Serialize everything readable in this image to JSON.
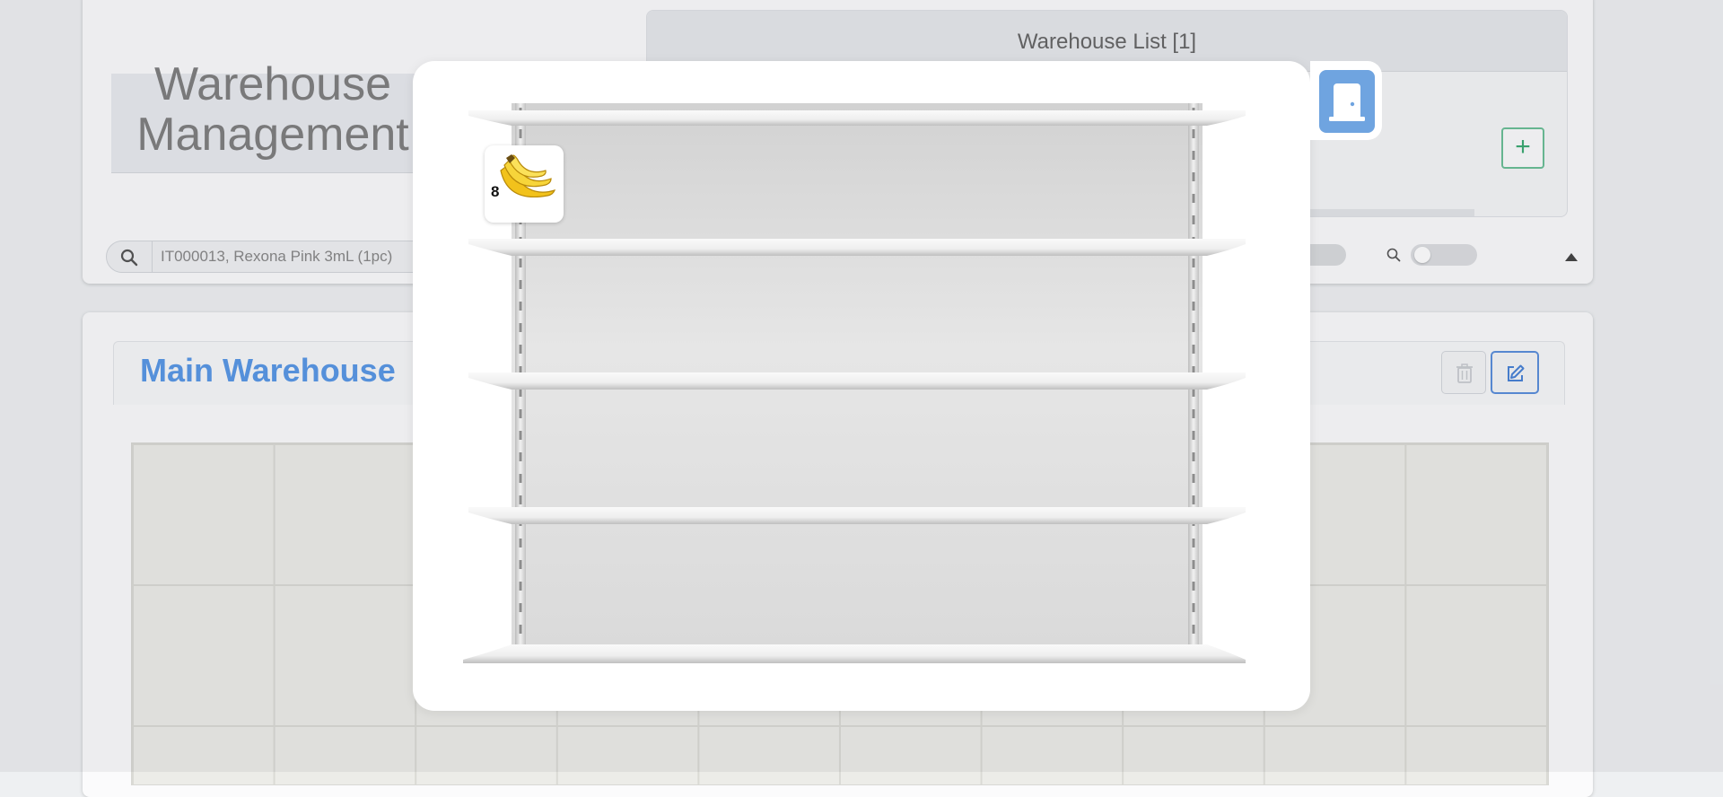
{
  "app": {
    "title": "Warehouse\nManagement"
  },
  "warehouse_list": {
    "header": "Warehouse List [1]",
    "add_label": "+"
  },
  "search": {
    "value": "IT000013, Rexona Pink 3mL (1pc)",
    "placeholder": ""
  },
  "main_warehouse": {
    "title": "Main Warehouse"
  },
  "shelf_modal": {
    "shelves": 5,
    "items": [
      {
        "icon": "banana-icon",
        "count": "8"
      }
    ]
  },
  "icons": {
    "search": "search-icon",
    "toggle_search": "search-icon",
    "collapse": "caret-up-icon",
    "delete": "trash-icon",
    "edit": "edit-icon",
    "exit": "door-icon"
  },
  "colors": {
    "accent_blue": "#5a98e6",
    "add_green": "#3dab73",
    "exit_button": "#6fa4e0"
  }
}
